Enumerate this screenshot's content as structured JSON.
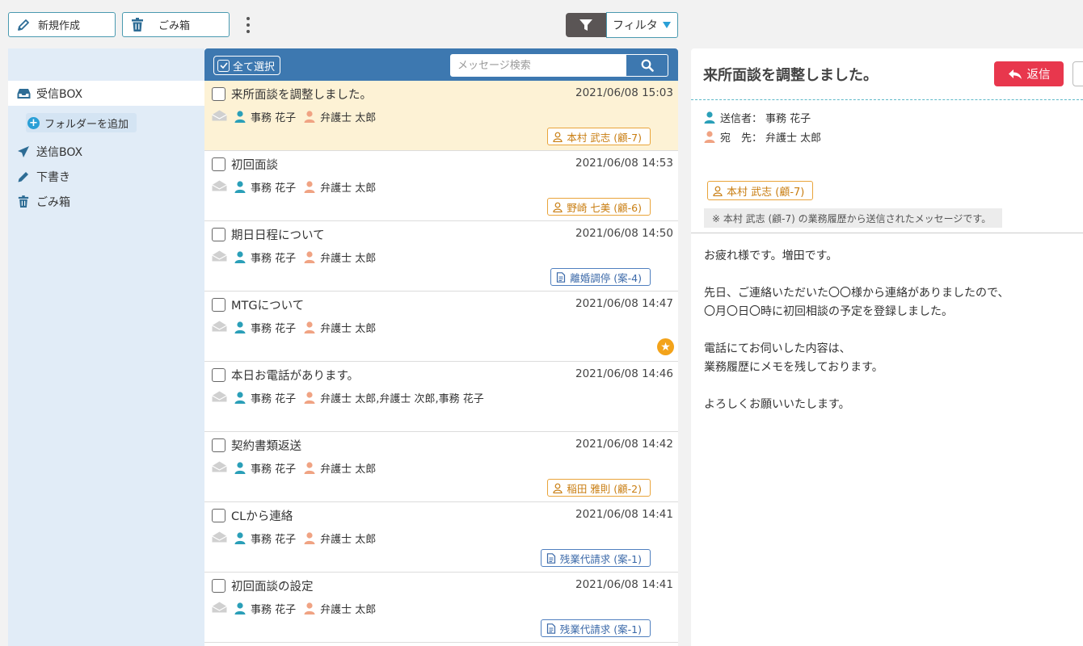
{
  "toolbar": {
    "new_label": "新規作成",
    "trash_label": "ごみ箱",
    "filter_label": "フィルタ"
  },
  "sidebar": {
    "inbox": "受信BOX",
    "add_folder": "フォルダーを追加",
    "sent": "送信BOX",
    "drafts": "下書き",
    "trash": "ごみ箱"
  },
  "list": {
    "select_all": "全て選択",
    "search_placeholder": "メッセージ検索",
    "messages": [
      {
        "subject": "来所面談を調整しました。",
        "date": "2021/06/08 15:03",
        "from": "事務 花子",
        "to": "弁護士 太郎",
        "tag": "本村 武志 (顧-7)",
        "tag_type": "person"
      },
      {
        "subject": "初回面談",
        "date": "2021/06/08 14:53",
        "from": "事務 花子",
        "to": "弁護士 太郎",
        "tag": "野崎 七美 (顧-6)",
        "tag_type": "person"
      },
      {
        "subject": "期日日程について",
        "date": "2021/06/08 14:50",
        "from": "事務 花子",
        "to": "弁護士 太郎",
        "tag": "離婚調停 (案-4)",
        "tag_type": "case"
      },
      {
        "subject": "MTGについて",
        "date": "2021/06/08 14:47",
        "from": "事務 花子",
        "to": "弁護士 太郎",
        "tag": "",
        "tag_type": "none",
        "starred": true
      },
      {
        "subject": "本日お電話があります。",
        "date": "2021/06/08 14:46",
        "from": "事務 花子",
        "to": "弁護士 太郎,弁護士 次郎,事務 花子",
        "tag": "",
        "tag_type": "none"
      },
      {
        "subject": "契約書類返送",
        "date": "2021/06/08 14:42",
        "from": "事務 花子",
        "to": "弁護士 太郎",
        "tag": "稲田 雅則 (顧-2)",
        "tag_type": "person"
      },
      {
        "subject": "CLから連絡",
        "date": "2021/06/08 14:41",
        "from": "事務 花子",
        "to": "弁護士 太郎",
        "tag": "残業代請求 (案-1)",
        "tag_type": "case"
      },
      {
        "subject": "初回面談の設定",
        "date": "2021/06/08 14:41",
        "from": "事務 花子",
        "to": "弁護士 太郎",
        "tag": "残業代請求 (案-1)",
        "tag_type": "case"
      }
    ]
  },
  "detail": {
    "title": "来所面談を調整しました。",
    "reply_label": "返信",
    "sender_label": "送信者：",
    "sender": "事務 花子",
    "recipient_label": "宛　先：",
    "recipient": "弁護士 太郎",
    "tag": "本村 武志 (顧-7)",
    "note": "※ 本村 武志 (顧-7) の業務履歴から送信されたメッセージです。",
    "body": "お疲れ様です。増田です。\n\n先日、ご連絡いただいた〇〇様から連絡がありましたので、\n〇月〇日〇時に初回相談の予定を登録しました。\n\n電話にてお伺いした内容は、\n業務履歴にメモを残しております。\n\nよろしくお願いいたします。"
  },
  "colors": {
    "accent_blue": "#3d78b0",
    "teal_border": "#4a9ab0",
    "reply_red": "#e8374d",
    "selected_row": "#fdf2d5",
    "sidebar_bg": "#e1ecf7",
    "tag_orange": "#e9a43a",
    "tag_blue": "#4f7fbf",
    "sender_icon": "#2a9fb8",
    "recipient_icon": "#f0a383"
  }
}
